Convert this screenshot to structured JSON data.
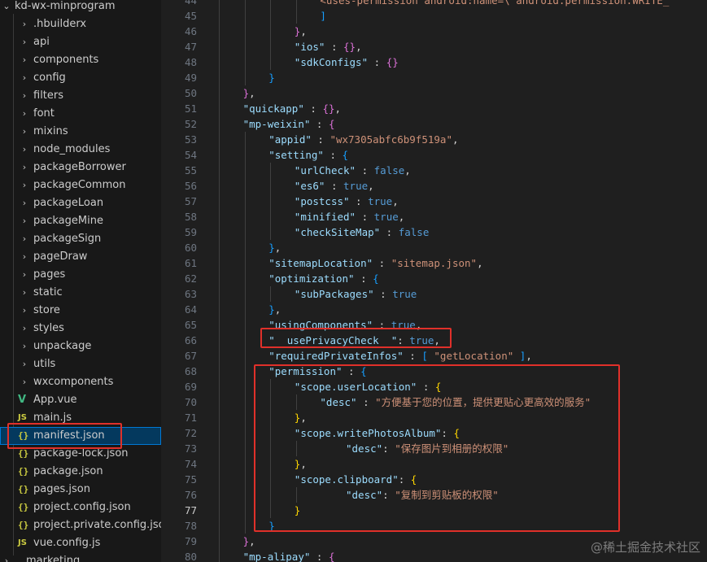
{
  "explorer": {
    "root_folder": "kd-wx-minprogram",
    "items": [
      {
        "label": ".hbuilderx",
        "type": "folder"
      },
      {
        "label": "api",
        "type": "folder"
      },
      {
        "label": "components",
        "type": "folder"
      },
      {
        "label": "config",
        "type": "folder"
      },
      {
        "label": "filters",
        "type": "folder"
      },
      {
        "label": "font",
        "type": "folder"
      },
      {
        "label": "mixins",
        "type": "folder"
      },
      {
        "label": "node_modules",
        "type": "folder"
      },
      {
        "label": "packageBorrower",
        "type": "folder"
      },
      {
        "label": "packageCommon",
        "type": "folder"
      },
      {
        "label": "packageLoan",
        "type": "folder"
      },
      {
        "label": "packageMine",
        "type": "folder"
      },
      {
        "label": "packageSign",
        "type": "folder"
      },
      {
        "label": "pageDraw",
        "type": "folder"
      },
      {
        "label": "pages",
        "type": "folder"
      },
      {
        "label": "static",
        "type": "folder"
      },
      {
        "label": "store",
        "type": "folder"
      },
      {
        "label": "styles",
        "type": "folder"
      },
      {
        "label": "unpackage",
        "type": "folder"
      },
      {
        "label": "utils",
        "type": "folder"
      },
      {
        "label": "wxcomponents",
        "type": "folder"
      },
      {
        "label": "App.vue",
        "type": "vue",
        "icon": "V"
      },
      {
        "label": "main.js",
        "type": "js",
        "icon": "JS"
      },
      {
        "label": "manifest.json",
        "type": "json",
        "icon": "{}",
        "selected": true
      },
      {
        "label": "package-lock.json",
        "type": "json",
        "icon": "{}"
      },
      {
        "label": "package.json",
        "type": "json",
        "icon": "{}"
      },
      {
        "label": "pages.json",
        "type": "json",
        "icon": "{}"
      },
      {
        "label": "project.config.json",
        "type": "json",
        "icon": "{}"
      },
      {
        "label": "project.private.config.json",
        "type": "json",
        "icon": "{}"
      },
      {
        "label": "vue.config.js",
        "type": "js",
        "icon": "JS"
      }
    ],
    "next_root_folder": "marketing"
  },
  "editor": {
    "current_line": "77",
    "lines": [
      {
        "n": "44",
        "indent": 4,
        "tokens": [
          [
            "s",
            "<uses-permission android:name=\\\"android.permission.WRITE_"
          ]
        ]
      },
      {
        "n": "45",
        "indent": 4,
        "tokens": [
          [
            "b3",
            "]"
          ]
        ]
      },
      {
        "n": "46",
        "indent": 3,
        "tokens": [
          [
            "b2",
            "}"
          ],
          [
            "p",
            ","
          ]
        ]
      },
      {
        "n": "47",
        "indent": 3,
        "tokens": [
          [
            "k",
            "\"ios\""
          ],
          [
            "p",
            " : "
          ],
          [
            "b2",
            "{}"
          ],
          [
            "p",
            ","
          ]
        ]
      },
      {
        "n": "48",
        "indent": 3,
        "tokens": [
          [
            "k",
            "\"sdkConfigs\""
          ],
          [
            "p",
            " : "
          ],
          [
            "b2",
            "{}"
          ]
        ]
      },
      {
        "n": "49",
        "indent": 2,
        "tokens": [
          [
            "b3",
            "}"
          ]
        ]
      },
      {
        "n": "50",
        "indent": 1,
        "tokens": [
          [
            "b2",
            "}"
          ],
          [
            "p",
            ","
          ]
        ]
      },
      {
        "n": "51",
        "indent": 1,
        "tokens": [
          [
            "k",
            "\"quickapp\""
          ],
          [
            "p",
            " : "
          ],
          [
            "b2",
            "{}"
          ],
          [
            "p",
            ","
          ]
        ]
      },
      {
        "n": "52",
        "indent": 1,
        "tokens": [
          [
            "k",
            "\"mp-weixin\""
          ],
          [
            "p",
            " : "
          ],
          [
            "b2",
            "{"
          ]
        ]
      },
      {
        "n": "53",
        "indent": 2,
        "tokens": [
          [
            "k",
            "\"appid\""
          ],
          [
            "p",
            " : "
          ],
          [
            "s",
            "\"wx7305abfc6b9f519a\""
          ],
          [
            "p",
            ","
          ]
        ]
      },
      {
        "n": "54",
        "indent": 2,
        "tokens": [
          [
            "k",
            "\"setting\""
          ],
          [
            "p",
            " : "
          ],
          [
            "b3",
            "{"
          ]
        ]
      },
      {
        "n": "55",
        "indent": 3,
        "tokens": [
          [
            "k",
            "\"urlCheck\""
          ],
          [
            "p",
            " : "
          ],
          [
            "kw",
            "false"
          ],
          [
            "p",
            ","
          ]
        ]
      },
      {
        "n": "56",
        "indent": 3,
        "tokens": [
          [
            "k",
            "\"es6\""
          ],
          [
            "p",
            " : "
          ],
          [
            "kw",
            "true"
          ],
          [
            "p",
            ","
          ]
        ]
      },
      {
        "n": "57",
        "indent": 3,
        "tokens": [
          [
            "k",
            "\"postcss\""
          ],
          [
            "p",
            " : "
          ],
          [
            "kw",
            "true"
          ],
          [
            "p",
            ","
          ]
        ]
      },
      {
        "n": "58",
        "indent": 3,
        "tokens": [
          [
            "k",
            "\"minified\""
          ],
          [
            "p",
            " : "
          ],
          [
            "kw",
            "true"
          ],
          [
            "p",
            ","
          ]
        ]
      },
      {
        "n": "59",
        "indent": 3,
        "tokens": [
          [
            "k",
            "\"checkSiteMap\""
          ],
          [
            "p",
            " : "
          ],
          [
            "kw",
            "false"
          ]
        ]
      },
      {
        "n": "60",
        "indent": 2,
        "tokens": [
          [
            "b3",
            "}"
          ],
          [
            "p",
            ","
          ]
        ]
      },
      {
        "n": "61",
        "indent": 2,
        "tokens": [
          [
            "k",
            "\"sitemapLocation\""
          ],
          [
            "p",
            " : "
          ],
          [
            "s",
            "\"sitemap.json\""
          ],
          [
            "p",
            ","
          ]
        ]
      },
      {
        "n": "62",
        "indent": 2,
        "tokens": [
          [
            "k",
            "\"optimization\""
          ],
          [
            "p",
            " : "
          ],
          [
            "b3",
            "{"
          ]
        ]
      },
      {
        "n": "63",
        "indent": 3,
        "tokens": [
          [
            "k",
            "\"subPackages\""
          ],
          [
            "p",
            " : "
          ],
          [
            "kw",
            "true"
          ]
        ]
      },
      {
        "n": "64",
        "indent": 2,
        "tokens": [
          [
            "b3",
            "}"
          ],
          [
            "p",
            ","
          ]
        ]
      },
      {
        "n": "65",
        "indent": 2,
        "tokens": [
          [
            "k",
            "\"usingComponents\""
          ],
          [
            "p",
            " : "
          ],
          [
            "kw",
            "true"
          ],
          [
            "p",
            ","
          ]
        ]
      },
      {
        "n": "66",
        "indent": 2,
        "tokens": [
          [
            "k",
            "\"  usePrivacyCheck  \""
          ],
          [
            "p",
            ": "
          ],
          [
            "kw",
            "true"
          ],
          [
            "p",
            ","
          ]
        ]
      },
      {
        "n": "67",
        "indent": 2,
        "tokens": [
          [
            "k",
            "\"requiredPrivateInfos\""
          ],
          [
            "p",
            " : "
          ],
          [
            "b3",
            "["
          ],
          [
            "p",
            " "
          ],
          [
            "s",
            "\"getLocation\""
          ],
          [
            "p",
            " "
          ],
          [
            "b3",
            "]"
          ],
          [
            "p",
            ","
          ]
        ]
      },
      {
        "n": "68",
        "indent": 2,
        "tokens": [
          [
            "k",
            "\"permission\""
          ],
          [
            "p",
            " : "
          ],
          [
            "b3",
            "{"
          ]
        ]
      },
      {
        "n": "69",
        "indent": 3,
        "tokens": [
          [
            "k",
            "\"scope.userLocation\""
          ],
          [
            "p",
            " : "
          ],
          [
            "b1",
            "{"
          ]
        ]
      },
      {
        "n": "70",
        "indent": 4,
        "tokens": [
          [
            "k",
            "\"desc\""
          ],
          [
            "p",
            " : "
          ],
          [
            "s",
            "\"方便基于您的位置，提供更贴心更高效的服务\""
          ]
        ]
      },
      {
        "n": "71",
        "indent": 3,
        "tokens": [
          [
            "b1",
            "}"
          ],
          [
            "p",
            ","
          ]
        ]
      },
      {
        "n": "72",
        "indent": 3,
        "tokens": [
          [
            "k",
            "\"scope.writePhotosAlbum\""
          ],
          [
            "p",
            ": "
          ],
          [
            "b1",
            "{"
          ]
        ]
      },
      {
        "n": "73",
        "indent": 5,
        "tokens": [
          [
            "k",
            "\"desc\""
          ],
          [
            "p",
            ": "
          ],
          [
            "s",
            "\"保存图片到相册的权限\""
          ]
        ]
      },
      {
        "n": "74",
        "indent": 3,
        "tokens": [
          [
            "b1",
            "}"
          ],
          [
            "p",
            ","
          ]
        ]
      },
      {
        "n": "75",
        "indent": 3,
        "tokens": [
          [
            "k",
            "\"scope.clipboard\""
          ],
          [
            "p",
            ": "
          ],
          [
            "b1",
            "{"
          ]
        ]
      },
      {
        "n": "76",
        "indent": 5,
        "tokens": [
          [
            "k",
            "\"desc\""
          ],
          [
            "p",
            ": "
          ],
          [
            "s",
            "\"复制到剪贴板的权限\""
          ]
        ]
      },
      {
        "n": "77",
        "indent": 3,
        "tokens": [
          [
            "b1",
            "}"
          ]
        ]
      },
      {
        "n": "78",
        "indent": 2,
        "tokens": [
          [
            "b3",
            "}"
          ]
        ]
      },
      {
        "n": "79",
        "indent": 1,
        "tokens": [
          [
            "b2",
            "}"
          ],
          [
            "p",
            ","
          ]
        ]
      },
      {
        "n": "80",
        "indent": 1,
        "tokens": [
          [
            "k",
            "\"mp-alipay\""
          ],
          [
            "p",
            " : "
          ],
          [
            "b2",
            "{"
          ]
        ]
      }
    ]
  },
  "watermark": "@稀土掘金技术社区",
  "colors": {
    "annotation": "#e0302a",
    "selection": "#04395e",
    "key": "#9cdcfe",
    "string": "#ce9178",
    "keyword": "#569cd6"
  }
}
